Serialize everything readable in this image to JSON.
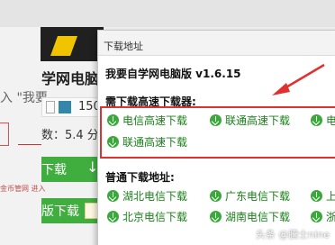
{
  "background": {
    "site_title": "学网电脑版",
    "input_hint": "入 \"我要",
    "count": "150",
    "score": "数：5.4 分",
    "download_btn": "下载",
    "download_btn2": "版下载",
    "tag_text": "金币管网 \n 进入"
  },
  "dialog": {
    "title": "下载地址",
    "app_name": "我要自学网电脑版 v1.6.15",
    "fast_section": {
      "label": "需下载高速下载器:",
      "links": [
        "电信高速下载",
        "联通高速下载",
        "电",
        "联通高速下载"
      ]
    },
    "normal_section": {
      "label": "普通下载地址:",
      "links": [
        "湖北电信下载",
        "广东电信下载",
        "上",
        "北京电信下载",
        "湖南电信下载",
        "浙"
      ]
    }
  },
  "watermark": "头条 @騰士nine",
  "colors": {
    "accent_green": "#3aa83a",
    "highlight_red": "#e03030"
  },
  "icons": {
    "download": "download-circle-icon",
    "arrow": "annotation-arrow"
  }
}
